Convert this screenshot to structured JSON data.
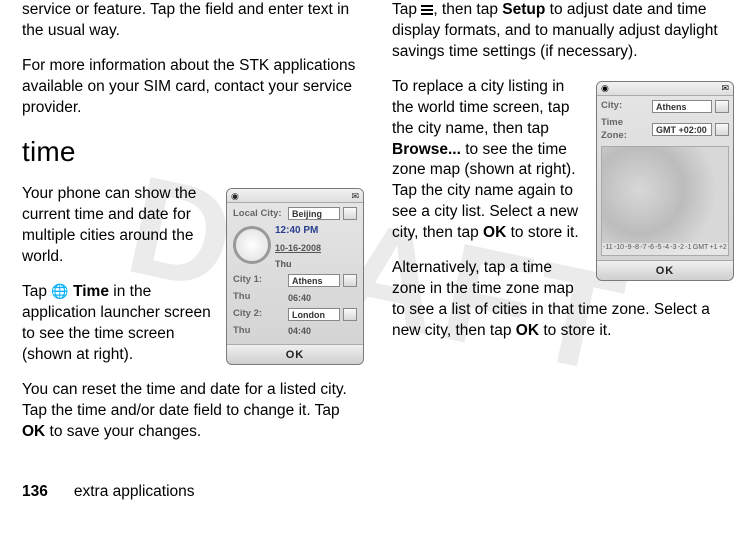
{
  "watermark": "DRAFT",
  "left": {
    "p1": "service or feature. Tap the field and enter text in the usual way.",
    "p2": "For more information about the STK applications available on your SIM card, contact your service provider.",
    "heading": "time",
    "p3": "Your phone can show the current time and date for multiple cities around the world.",
    "p4_pre": "Tap ",
    "p4_time": "Time",
    "p4_post": " in the application launcher screen to see the time screen (shown at right).",
    "p5_pre": "You can reset the time and date for a listed city. Tap the time and/or date field to change it. Tap ",
    "p5_ok": "OK",
    "p5_post": " to save your changes."
  },
  "right": {
    "p1_pre": "Tap ",
    "p1_mid": ", then tap ",
    "p1_setup": "Setup",
    "p1_post": " to adjust date and time display formats, and to manually adjust daylight savings time settings (if necessary).",
    "p2_pre": "To replace a city listing in the world time screen, tap the city name, then tap ",
    "p2_browse": "Browse...",
    "p2_mid": " to see the time zone map (shown at right). Tap the city name again to see a city list. Select a new city, then tap ",
    "p2_ok": "OK",
    "p2_post": " to store it.",
    "p3_pre": "Alternatively, tap a time zone in the time zone map to see a list of cities in that time zone. Select a new city, then tap ",
    "p3_ok": "OK",
    "p3_post": " to store it."
  },
  "footer": {
    "page": "136",
    "label": "extra applications"
  },
  "phone1": {
    "localCityLabel": "Local City:",
    "localCity": "Beijing",
    "time": "12:40 PM",
    "date": "10-16-2008",
    "day": "Thu",
    "city1Label": "City 1:",
    "city1": "Athens",
    "thu1": "Thu",
    "t1": "06:40",
    "city2Label": "City 2:",
    "city2": "London",
    "thu2": "Thu",
    "t2": "04:40",
    "ok": "OK"
  },
  "phone2": {
    "cityLabel": "City:",
    "city": "Athens",
    "tzLabel": "Time Zone:",
    "tz": "GMT +02:00",
    "ticks": [
      "-11",
      "-10",
      "-9",
      "-8",
      "-7",
      "-6",
      "-5",
      "-4",
      "-3",
      "-2",
      "-1",
      "GMT",
      "+1",
      "+2"
    ],
    "ok": "OK"
  }
}
